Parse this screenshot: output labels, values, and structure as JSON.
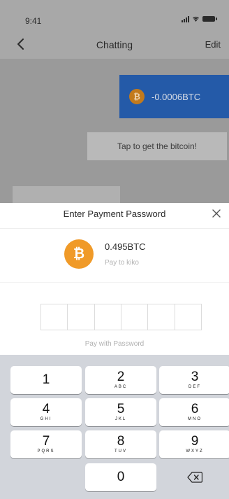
{
  "status_bar": {
    "time": "9:41"
  },
  "nav": {
    "title": "Chatting",
    "edit_label": "Edit"
  },
  "chat": {
    "btc_message": {
      "amount": "-0.0006BTC",
      "coin_glyph": "₿"
    },
    "tap_message": "Tap to get the bitcoin!"
  },
  "payment": {
    "title": "Enter Payment Password",
    "coin_glyph": "₿",
    "amount": "0.495BTC",
    "pay_to": "Pay to kiko",
    "hint": "Pay with Password",
    "pin_length": 6
  },
  "keypad": {
    "keys": [
      {
        "num": "1",
        "letters": ""
      },
      {
        "num": "2",
        "letters": "ABC"
      },
      {
        "num": "3",
        "letters": "DEF"
      },
      {
        "num": "4",
        "letters": "GHI"
      },
      {
        "num": "5",
        "letters": "JKL"
      },
      {
        "num": "6",
        "letters": "MNO"
      },
      {
        "num": "7",
        "letters": "PQRS"
      },
      {
        "num": "8",
        "letters": "TUV"
      },
      {
        "num": "9",
        "letters": "WXYZ"
      },
      {
        "num": "0",
        "letters": ""
      }
    ]
  },
  "icons": {
    "back": "chevron-left-icon",
    "close": "close-icon",
    "delete": "backspace-icon",
    "bitcoin": "bitcoin-icon"
  },
  "colors": {
    "bitcoin_orange": "#f09a28",
    "message_blue": "#245aa8",
    "keypad_bg": "#d2d5db"
  }
}
